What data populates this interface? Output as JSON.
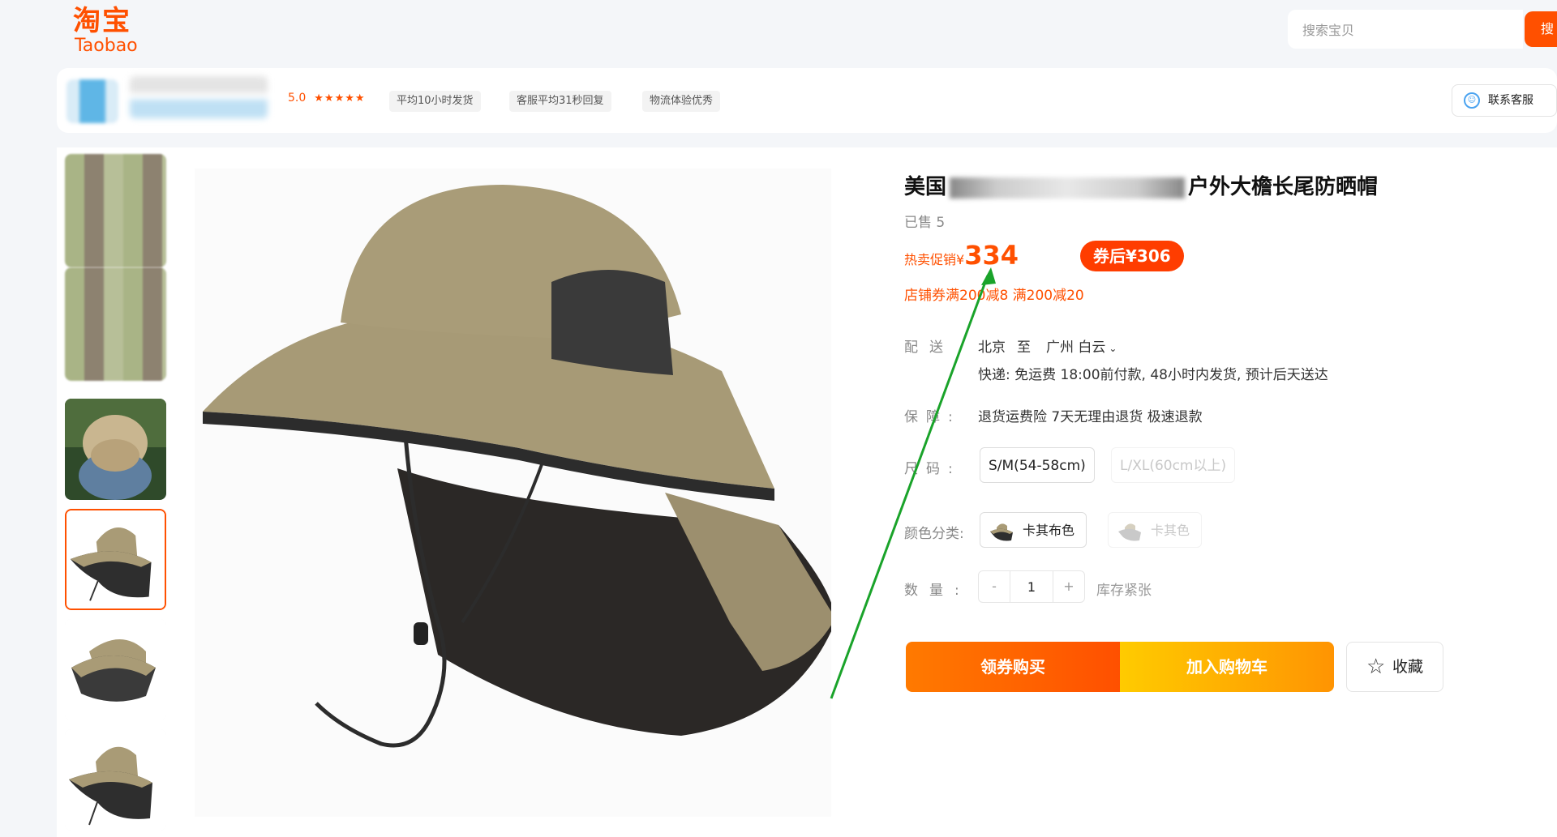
{
  "header": {
    "logo_cn": "淘宝",
    "logo_en": "Taobao",
    "search_placeholder": "搜索宝贝",
    "search_button": "搜"
  },
  "shop": {
    "rating": "5.0",
    "stars": "★★★★★",
    "tags": [
      "平均10小时发货",
      "客服平均31秒回复",
      "物流体验优秀"
    ],
    "service_label": "联系客服"
  },
  "product": {
    "title_prefix": "美国",
    "title_suffix": "户外大檐长尾防晒帽",
    "sold": "已售 5",
    "price_label": "热卖促销¥",
    "price": "334",
    "coupon_price": "券后¥306",
    "promo": "店铺券满200减8 满200减20",
    "delivery": {
      "label": "配送",
      "from": "北京",
      "to_word": "至",
      "to": "广州 白云",
      "detail": "快递: 免运费  18:00前付款, 48小时内发货, 预计后天送达"
    },
    "guarantee": {
      "label": "保障:",
      "text": "退货运费险 7天无理由退货 极速退款"
    },
    "size": {
      "label": "尺码:",
      "options": [
        "S/M(54-58cm)",
        "L/XL(60cm以上)"
      ]
    },
    "color": {
      "label": "颜色分类:",
      "options": [
        "卡其布色",
        "卡其色"
      ]
    },
    "quantity": {
      "label": "数量:",
      "minus": "-",
      "value": "1",
      "plus": "+",
      "stock": "库存紧张"
    },
    "buttons": {
      "buy": "领券购买",
      "cart": "加入购物车",
      "favorite": "收藏"
    }
  },
  "colors": {
    "brand": "#ff5000",
    "annotation_arrow": "#1aa32a"
  }
}
